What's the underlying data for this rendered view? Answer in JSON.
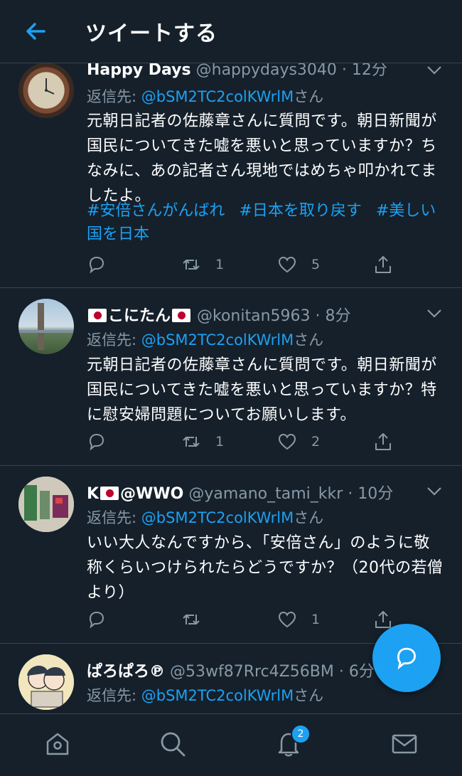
{
  "header": {
    "title": "ツイートする"
  },
  "tweets": [
    {
      "name": "Happy Days",
      "handle": "@happydays3040",
      "time": "12分",
      "reply_prefix": "返信先: ",
      "reply_to": "@bSM2TC2colKWrlM",
      "reply_suffix": "さん",
      "text": "元朝日記者の佐藤章さんに質問です。朝日新聞が国民についてきた嘘を悪いと思っていますか？ちなみに、あの記者さん現地ではめちゃ叩かれてましたよ。",
      "hashtags": [
        "#安倍さんがんばれ",
        "#日本を取り戻す",
        "#美しい国を日本"
      ],
      "replies": "",
      "retweets": "1",
      "likes": "5"
    },
    {
      "name": "こにたん",
      "handle": "@konitan5963",
      "time": "8分",
      "reply_prefix": "返信先: ",
      "reply_to": "@bSM2TC2colKWrlM",
      "reply_suffix": "さん",
      "text": "元朝日記者の佐藤章さんに質問です。朝日新聞が国民についてきた嘘を悪いと思っていますか？特に慰安婦問題についてお願いします。",
      "replies": "",
      "retweets": "1",
      "likes": "2"
    },
    {
      "name_prefix": "K",
      "name_suffix": "@WWO",
      "handle": "@yamano_tami_kkr",
      "time": "10分",
      "reply_prefix": "返信先: ",
      "reply_to": "@bSM2TC2colKWrlM",
      "reply_suffix": "さん",
      "text": "いい大人なんですから、「安倍さん」のように敬称くらいつけられたらどうですか？（20代の若僧より）",
      "replies": "",
      "retweets": "",
      "likes": "1"
    },
    {
      "name": "ぱろぱろ℗",
      "handle": "@53wf87Rrc4Z56BM",
      "time": "6分",
      "reply_prefix": "返信先: ",
      "reply_to": "@bSM2TC2colKWrlM",
      "reply_suffix": "さん"
    }
  ],
  "tabbar": {
    "notification_badge": "2"
  },
  "colors": {
    "background": "#15202b",
    "accent": "#1da1f2",
    "muted": "#8899a6",
    "divider": "#38444d"
  },
  "icons": [
    "back-arrow-icon",
    "chevron-down-icon",
    "reply-icon",
    "retweet-icon",
    "like-icon",
    "share-icon",
    "compose-reply-icon",
    "home-icon",
    "search-icon",
    "notifications-icon",
    "messages-icon"
  ]
}
